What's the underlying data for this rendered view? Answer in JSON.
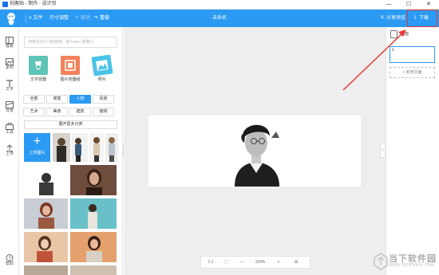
{
  "window": {
    "title": "创客贴 - 制作 - 设计页",
    "minimize": "—",
    "maximize": "☐",
    "close": "✕"
  },
  "toolbar": {
    "file": "文件",
    "size": "尺寸调整",
    "undo": "撤销",
    "redo": "重做",
    "doc_title": "未命名",
    "share": "分享预览",
    "download": "下载"
  },
  "rail": {
    "items": [
      {
        "label": "模板",
        "icon": "template-icon"
      },
      {
        "label": "素材",
        "icon": "material-icon"
      },
      {
        "label": "文字",
        "icon": "text-icon"
      },
      {
        "label": "背景",
        "icon": "background-icon"
      },
      {
        "label": "工具",
        "icon": "tools-icon"
      },
      {
        "label": "上传",
        "icon": "upload-icon"
      }
    ],
    "help": "帮助"
  },
  "panel": {
    "search_placeholder": "搜索素材/人物/景物，按 Enter 键确认",
    "categories": [
      {
        "label": "文字容器",
        "color": "#5ec4b6"
      },
      {
        "label": "图片容器组",
        "color": "#f3825a"
      },
      {
        "label": "照片",
        "color": "#4cc3e8"
      }
    ],
    "tags": [
      "全部",
      "简笔",
      "人物",
      "风景",
      "艺术",
      "美食",
      "建筑",
      "植物"
    ],
    "active_tag": "人物",
    "more": "展开更多分类",
    "upload_label": "上传图片"
  },
  "canvas": {
    "zoom": {
      "ratio": "1:1",
      "fit": "⛶",
      "minus": "—",
      "value": "104%",
      "plus": "+",
      "grid": "⊞"
    }
  },
  "right_panel": {
    "pages_label": "页面",
    "page_number": "1",
    "add_page": "新增页面"
  },
  "watermark": {
    "name": "当下软件园",
    "sub": "WWW.DOWNXIA.COM"
  },
  "colors": {
    "accent": "#2b9af3",
    "annotation": "#e53935"
  }
}
